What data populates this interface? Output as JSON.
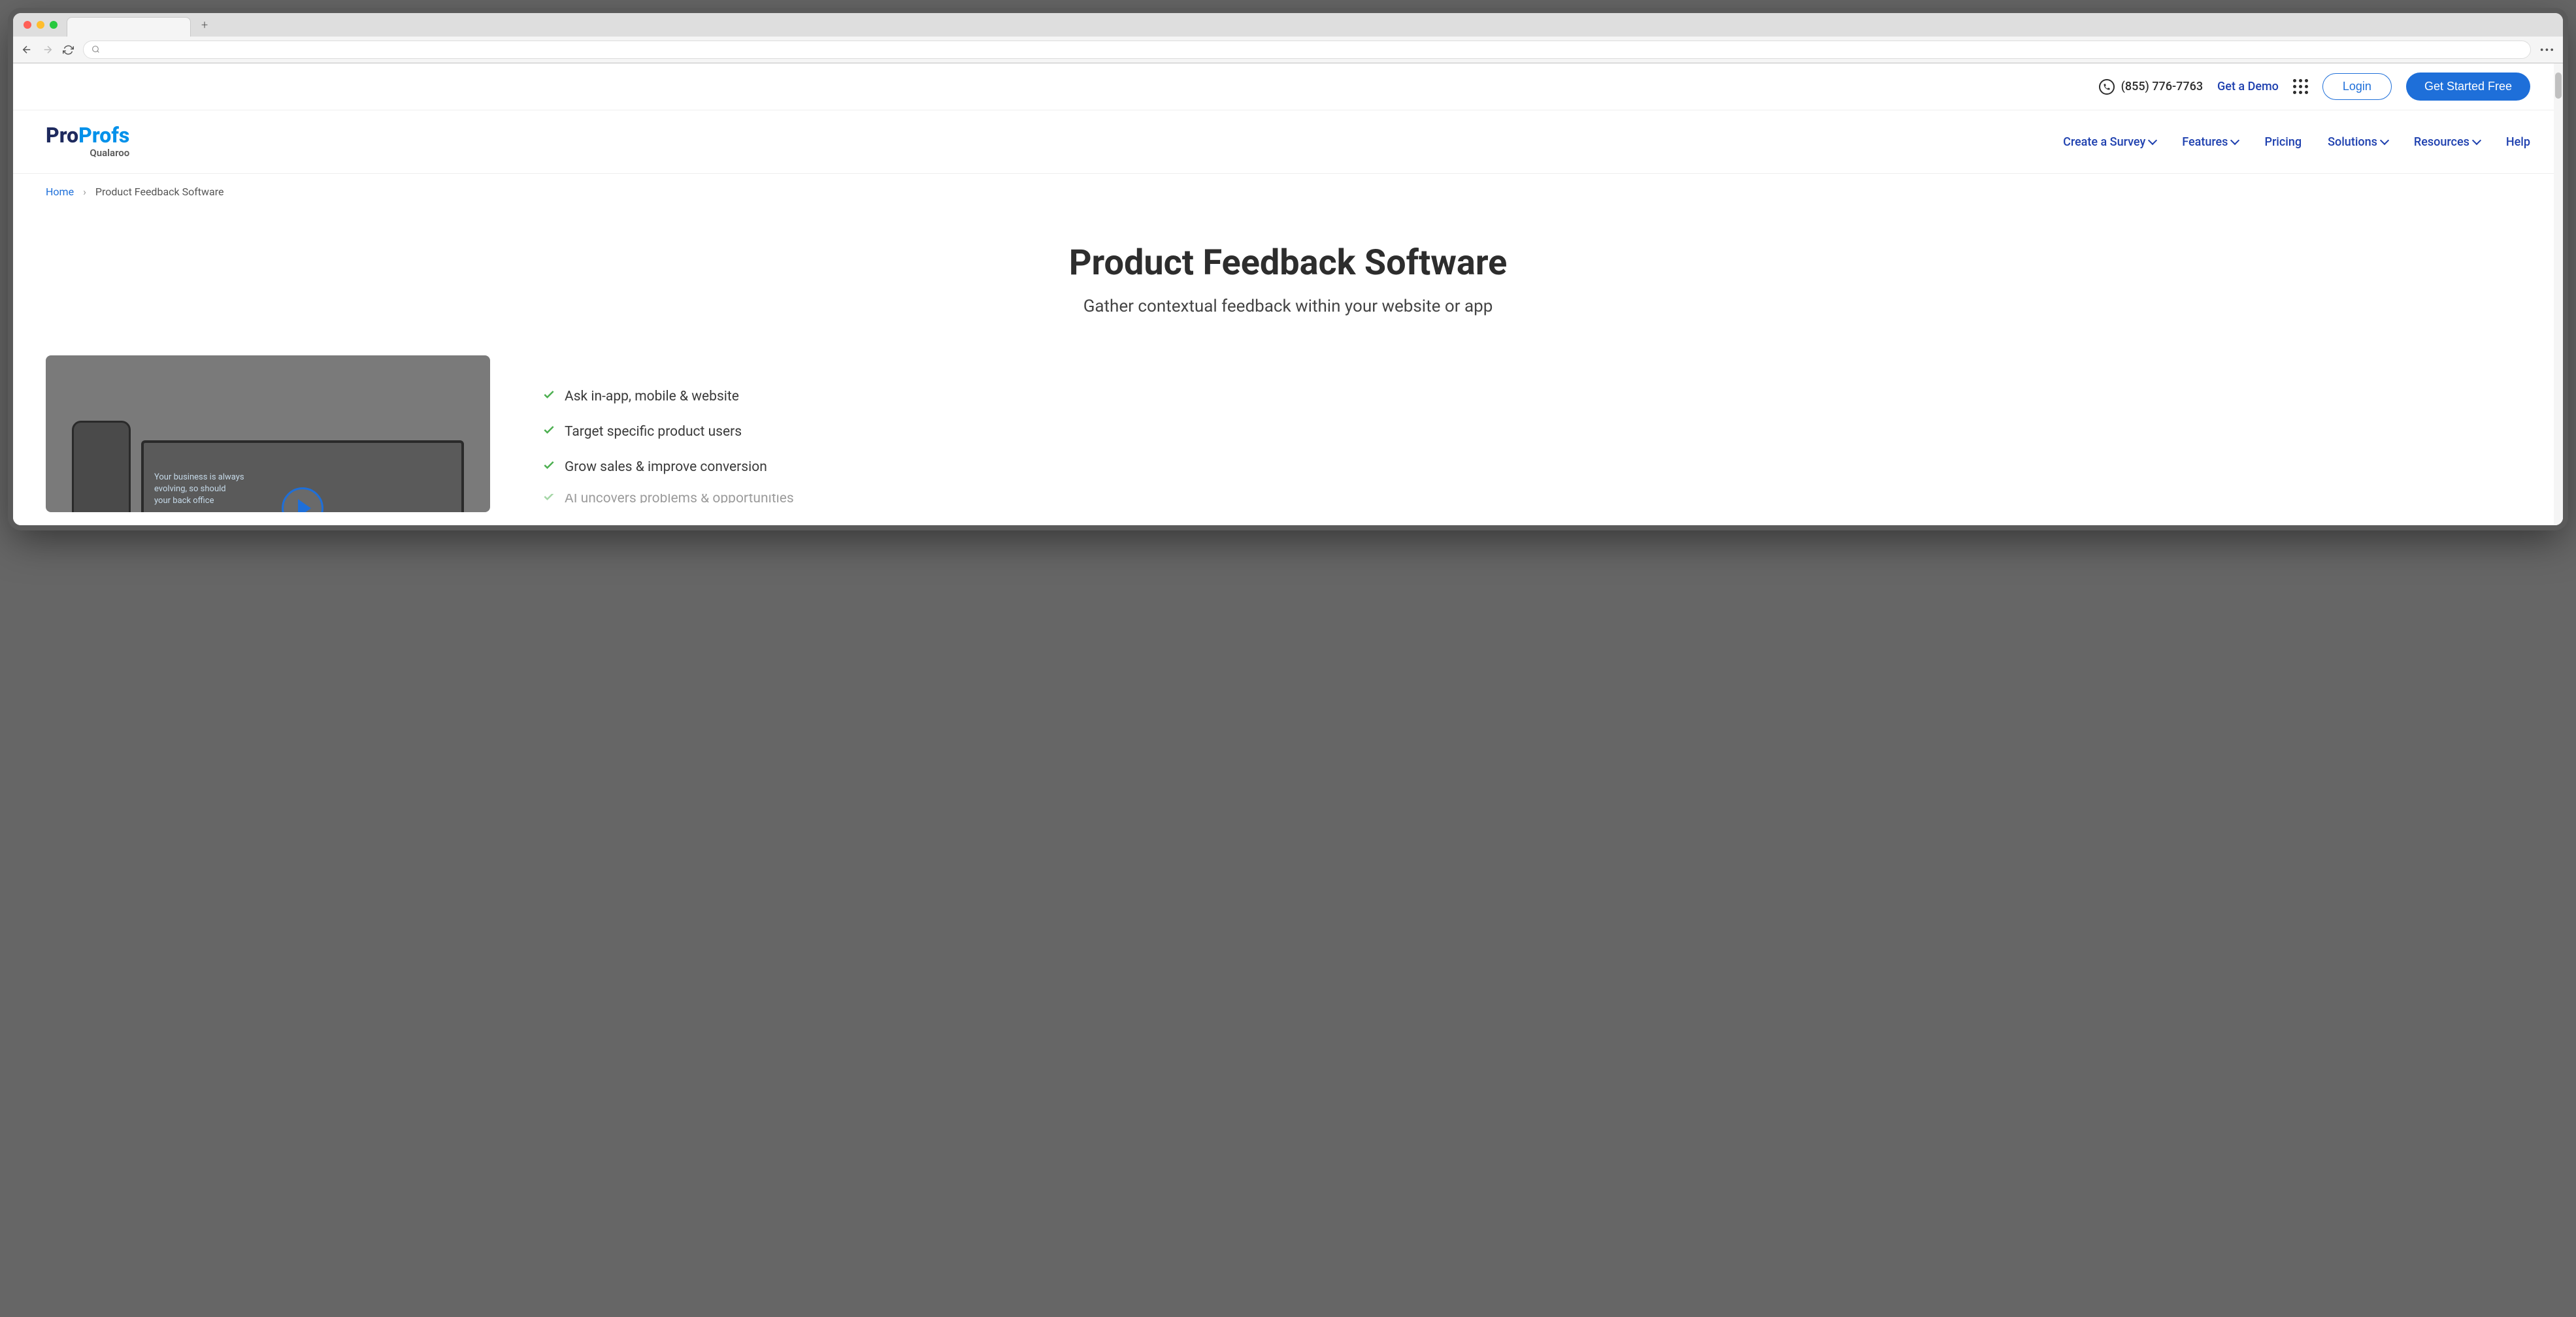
{
  "top_bar": {
    "phone": "(855) 776-7763",
    "demo_link": "Get a Demo",
    "login": "Login",
    "cta": "Get Started Free"
  },
  "logo": {
    "part1": "Pro",
    "part2": "Profs",
    "subtitle": "Qualaroo"
  },
  "nav": {
    "items": [
      {
        "label": "Create a Survey",
        "dropdown": true
      },
      {
        "label": "Features",
        "dropdown": true
      },
      {
        "label": "Pricing",
        "dropdown": false
      },
      {
        "label": "Solutions",
        "dropdown": true
      },
      {
        "label": "Resources",
        "dropdown": true
      },
      {
        "label": "Help",
        "dropdown": false
      }
    ]
  },
  "breadcrumb": {
    "home": "Home",
    "separator": "›",
    "current": "Product Feedback Software"
  },
  "hero": {
    "title": "Product Feedback Software",
    "subtitle": "Gather contextual feedback within your website or app"
  },
  "video": {
    "teaser_line1": "Your business is always",
    "teaser_line2": "evolving, so should",
    "teaser_line3": "your back office"
  },
  "benefits": [
    "Ask in-app, mobile & website",
    "Target specific product users",
    "Grow sales & improve conversion",
    "AI uncovers problems & opportunities"
  ]
}
